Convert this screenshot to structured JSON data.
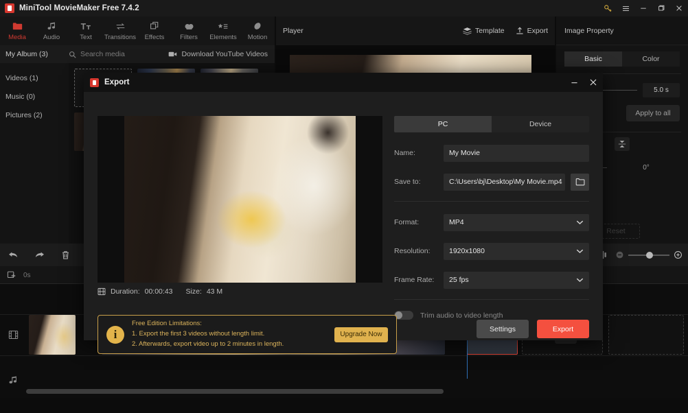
{
  "titlebar": {
    "app_title": "MiniTool MovieMaker Free 7.4.2",
    "logo_icon": "minitool-logo-icon",
    "key_icon": "key-icon",
    "menu_icon": "hamburger-menu-icon",
    "minimize_icon": "minimize-icon",
    "maximize_icon": "maximize-icon",
    "close_icon": "close-icon"
  },
  "navbar": {
    "items": [
      {
        "label": "Media",
        "icon": "folder-icon",
        "active": true
      },
      {
        "label": "Audio",
        "icon": "music-note-icon",
        "active": false
      },
      {
        "label": "Text",
        "icon": "text-tt-icon",
        "active": false
      },
      {
        "label": "Transitions",
        "icon": "transition-arrows-icon",
        "active": false
      },
      {
        "label": "Effects",
        "icon": "layers-square-icon",
        "active": false
      },
      {
        "label": "Filters",
        "icon": "droplets-icon",
        "active": false
      },
      {
        "label": "Elements",
        "icon": "star-list-icon",
        "active": false
      },
      {
        "label": "Motion",
        "icon": "motion-oval-icon",
        "active": false
      }
    ]
  },
  "library": {
    "album_label": "My Album (3)",
    "search_placeholder": "Search media",
    "search_icon": "search-icon",
    "youtube_label": "Download YouTube Videos",
    "youtube_icon": "video-camera-icon",
    "categories": [
      {
        "label": "Videos (1)"
      },
      {
        "label": "Music (0)"
      },
      {
        "label": "Pictures (2)"
      }
    ],
    "add_media_icon": "plus-icon"
  },
  "player": {
    "title": "Player",
    "template_label": "Template",
    "template_icon": "layers-stack-icon",
    "export_label": "Export",
    "export_icon": "upload-arrow-icon"
  },
  "property_panel": {
    "title": "Image Property",
    "tabs": [
      {
        "label": "Basic",
        "active": true
      },
      {
        "label": "Color",
        "active": false
      }
    ],
    "duration_value": "5.0 s",
    "apply_to_all_label": "Apply to all",
    "flip_icon": "flip-vertical-icon",
    "rotation_value": "0°",
    "reset_label": "Reset"
  },
  "timeline": {
    "undo_icon": "undo-arrow-icon",
    "redo_icon": "redo-arrow-icon",
    "delete_icon": "trash-icon",
    "split_icon": "split-icon",
    "zoom_out_icon": "zoom-out-icon",
    "zoom_in_icon": "zoom-in-icon",
    "add_media_icon": "add-media-icon",
    "start_time": "0s",
    "video_track_icon": "film-strip-icon",
    "audio_track_icon": "music-note-icon",
    "transition_slot_icon": "transition-arrows-icon"
  },
  "export_dialog": {
    "title": "Export",
    "logo_icon": "minitool-logo-icon",
    "minimize_icon": "minimize-icon",
    "close_icon": "close-icon",
    "preview": {
      "duration_label": "Duration:",
      "duration_value": "00:00:43",
      "size_label": "Size:",
      "size_value": "43 M",
      "meta_icon": "film-frame-icon"
    },
    "target_tabs": [
      {
        "label": "PC",
        "active": true
      },
      {
        "label": "Device",
        "active": false
      }
    ],
    "fields": [
      {
        "label": "Name:",
        "value": "My Movie",
        "type": "text",
        "name": "name-field"
      },
      {
        "label": "Save to:",
        "value": "C:\\Users\\bj\\Desktop\\My Movie.mp4",
        "type": "path",
        "name": "save-to-field"
      },
      {
        "label": "Format:",
        "value": "MP4",
        "type": "select",
        "name": "format-select"
      },
      {
        "label": "Resolution:",
        "value": "1920x1080",
        "type": "select",
        "name": "resolution-select"
      },
      {
        "label": "Frame Rate:",
        "value": "25 fps",
        "type": "select",
        "name": "frame-rate-select"
      }
    ],
    "browse_icon": "folder-open-icon",
    "chevron_icon": "chevron-down-icon",
    "trim_toggle": {
      "label": "Trim audio to video length",
      "enabled": false
    },
    "notice": {
      "icon": "info-icon",
      "heading": "Free Edition Limitations:",
      "line1": "1. Export the first 3 videos without length limit.",
      "line2": "2. Afterwards, export video up to 2 minutes in length.",
      "upgrade_label": "Upgrade Now"
    },
    "settings_label": "Settings",
    "export_label": "Export"
  },
  "colors": {
    "accent_red": "#cf3a31",
    "export_red": "#f4503f",
    "warning_gold": "#e0b24e",
    "panel_bg": "#1e1e1e",
    "app_bg": "#0c0c0c"
  }
}
